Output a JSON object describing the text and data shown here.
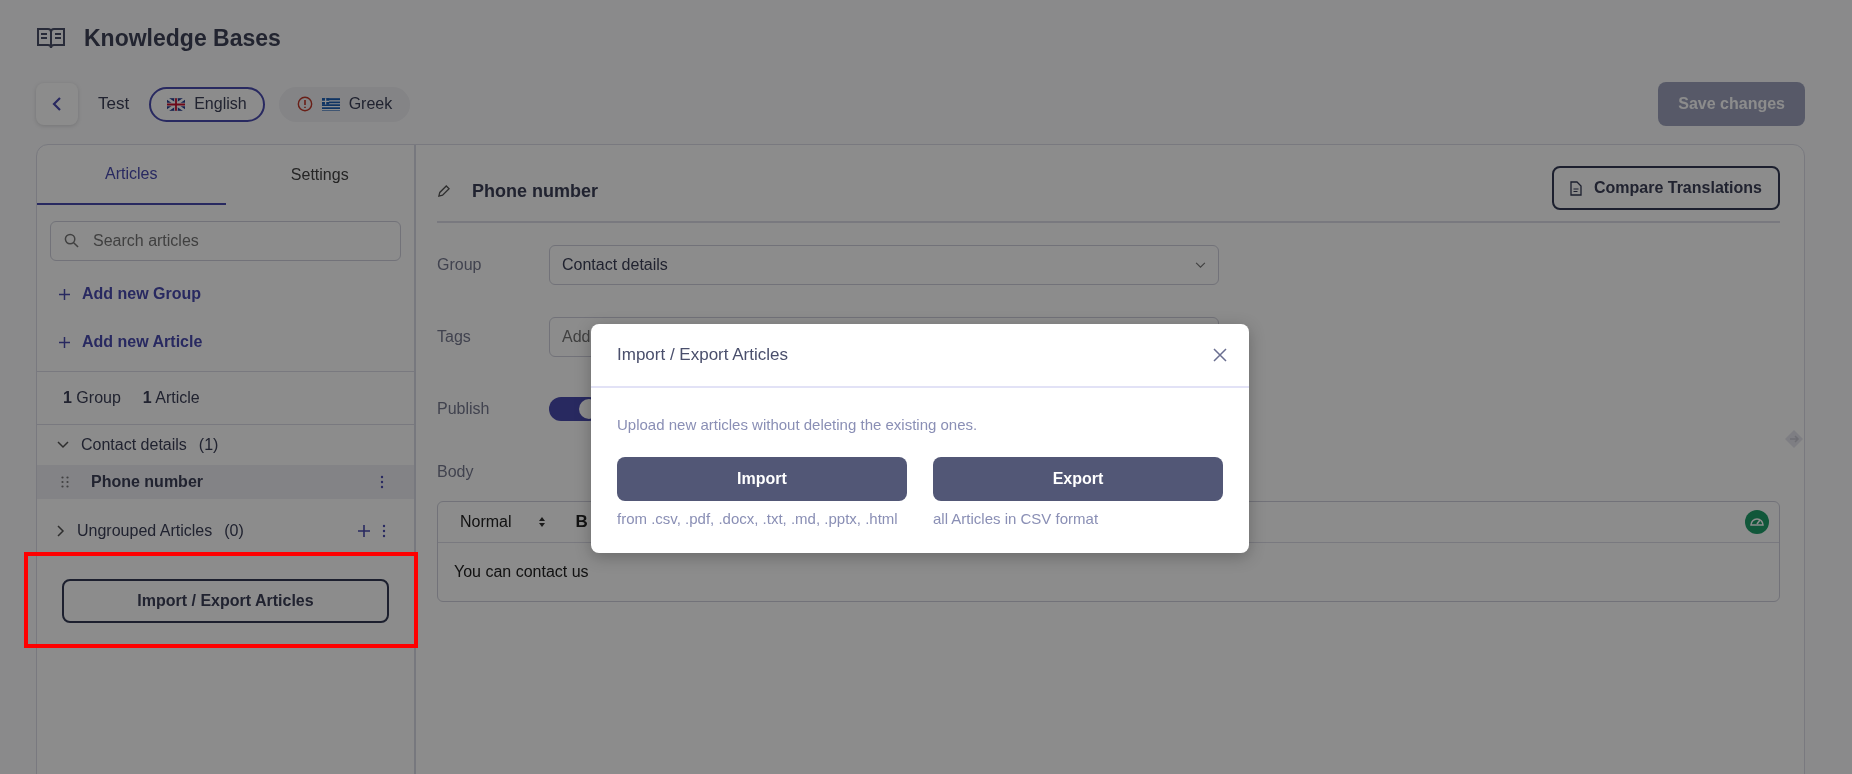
{
  "header": {
    "title": "Knowledge Bases"
  },
  "toolbar": {
    "base_name": "Test",
    "languages": [
      {
        "label": "English",
        "selected": true,
        "warning": false
      },
      {
        "label": "Greek",
        "selected": false,
        "warning": true
      }
    ],
    "save_button": "Save changes"
  },
  "sidebar": {
    "tabs": [
      {
        "label": "Articles",
        "selected": true
      },
      {
        "label": "Settings",
        "selected": false
      }
    ],
    "search": {
      "placeholder": "Search articles"
    },
    "actions": [
      "Add new Group",
      "Add new Article"
    ],
    "counts": [
      {
        "number": "1",
        "label": "Group"
      },
      {
        "number": "1",
        "label": "Article"
      }
    ],
    "groups": [
      {
        "name": "Contact details",
        "count": "(1)",
        "expanded": true,
        "actions_visible": false,
        "articles": [
          {
            "title": "Phone number",
            "selected": true
          }
        ]
      },
      {
        "name": "Ungrouped Articles",
        "count": "(0)",
        "expanded": false,
        "actions_visible": true
      }
    ],
    "import_export_button": "Import / Export Articles"
  },
  "editor": {
    "title": "Phone number",
    "compare_button": "Compare Translations",
    "fields": [
      {
        "kind": "select",
        "label": "Group",
        "value": "Contact details"
      },
      {
        "kind": "tags",
        "label": "Tags",
        "placeholder": "Add"
      },
      {
        "kind": "toggle",
        "label": "Publish",
        "on": true
      }
    ],
    "body": {
      "label": "Body",
      "format": "Normal",
      "bold_button": "B",
      "content": "You can contact us"
    }
  },
  "dialog": {
    "title": "Import / Export Articles",
    "description": "Upload new articles without deleting the existing ones.",
    "options": [
      {
        "label": "Import",
        "caption": "from .csv, .pdf, .docx, .txt, .md, .pptx, .html"
      },
      {
        "label": "Export",
        "caption": "all Articles in CSV format"
      }
    ]
  }
}
